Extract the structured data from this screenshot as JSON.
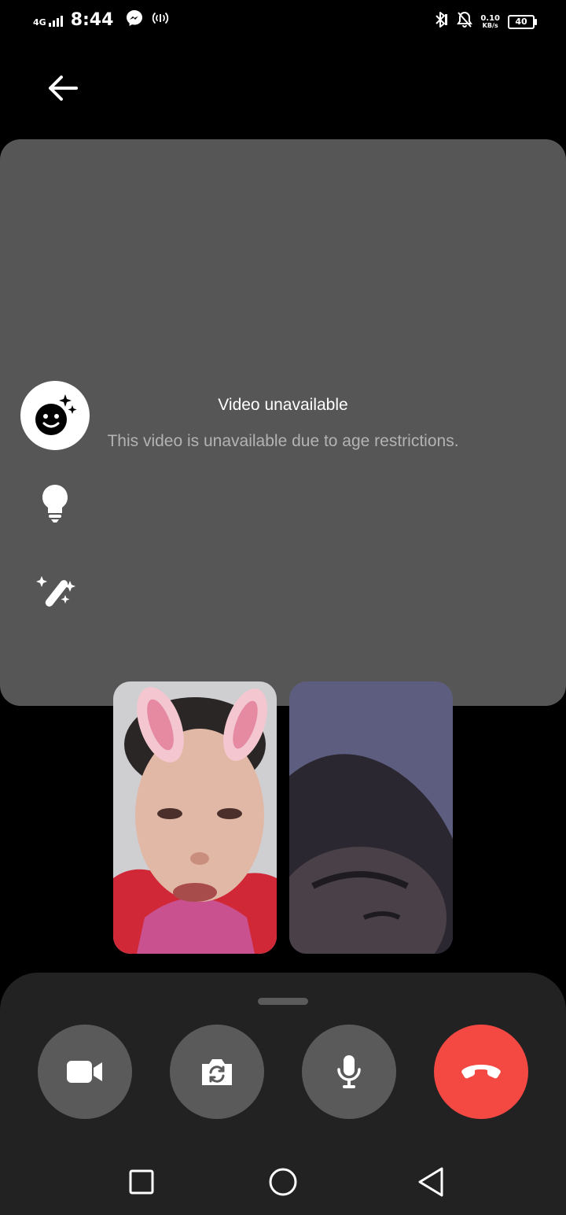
{
  "status_bar": {
    "network": "4G",
    "time": "8:44",
    "net_speed_value": "0.10",
    "net_speed_unit": "KB/s",
    "battery": "40"
  },
  "icons": {
    "back": "arrow-left-icon",
    "effects": "smiley-sparkle-icon",
    "bulb": "lightbulb-icon",
    "wand": "magic-wand-icon",
    "video": "video-camera-icon",
    "flip": "flip-camera-icon",
    "mic": "microphone-icon",
    "end": "hang-up-icon"
  },
  "video_panel": {
    "title": "Video unavailable",
    "description": "This video is unavailable due to age restrictions."
  },
  "colors": {
    "panel": "#565656",
    "control_bg": "#5a5a5a",
    "end_call": "#f44842",
    "sheet": "#222222"
  }
}
